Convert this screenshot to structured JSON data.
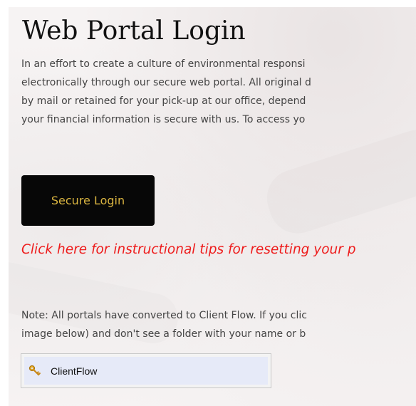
{
  "page": {
    "title": "Web Portal Login",
    "intro_lines": [
      "In an effort to create a culture of environmental responsi",
      "electronically through our secure web portal. All original d",
      "by mail or retained for your pick-up at our office, depend",
      "your financial information is secure with us. To access yo"
    ],
    "login_button_label": "Secure Login",
    "tips_link_text": "Click here for instructional tips for resetting your p",
    "note_lines": [
      "Note: All portals have converted to Client Flow. If you clic",
      "image below) and don't see a folder with your name or b"
    ],
    "clientflow": {
      "label": "ClientFlow",
      "icon": "key-icon"
    }
  },
  "colors": {
    "title": "#111111",
    "body_text": "#444444",
    "button_bg": "#070707",
    "button_text": "#d9b440",
    "link": "#ee1c1c",
    "clientflow_bg": "#e6eaf8"
  }
}
